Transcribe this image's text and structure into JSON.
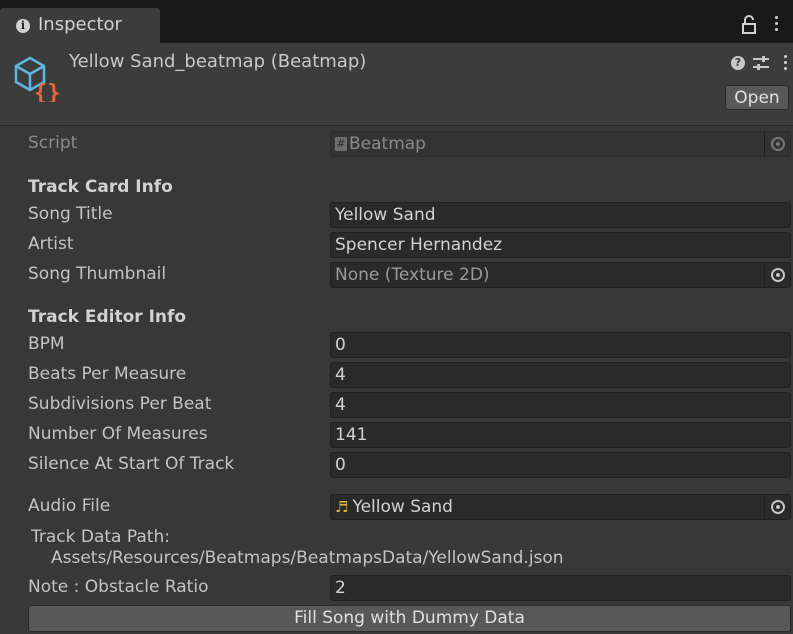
{
  "tab": {
    "label": "Inspector"
  },
  "header": {
    "title": "Yellow Sand_beatmap (Beatmap)",
    "open_label": "Open"
  },
  "script": {
    "label": "Script",
    "value": "Beatmap"
  },
  "track_card": {
    "heading": "Track Card Info",
    "song_title": {
      "label": "Song Title",
      "value": "Yellow Sand"
    },
    "artist": {
      "label": "Artist",
      "value": "Spencer Hernandez"
    },
    "thumbnail": {
      "label": "Song Thumbnail",
      "value": "None (Texture 2D)"
    }
  },
  "track_editor": {
    "heading": "Track Editor Info",
    "bpm": {
      "label": "BPM",
      "value": "0"
    },
    "beats_per_measure": {
      "label": "Beats Per Measure",
      "value": "4"
    },
    "subdivisions": {
      "label": "Subdivisions Per Beat",
      "value": "4"
    },
    "measures": {
      "label": "Number Of Measures",
      "value": "141"
    },
    "silence": {
      "label": "Silence At Start Of Track",
      "value": "0"
    }
  },
  "audio": {
    "label": "Audio File",
    "value": "Yellow Sand"
  },
  "data_path": {
    "label": "Track Data Path:",
    "value": "Assets/Resources/Beatmaps/BeatmapsData/YellowSand.json"
  },
  "ratio": {
    "label": "Note : Obstacle Ratio",
    "value": "2"
  },
  "dummy_button": {
    "label": "Fill Song with Dummy Data"
  },
  "colors": {
    "accent_orange": "#e8643a",
    "asset_blue": "#5fb7e0",
    "music_yellow": "#e8b33a"
  },
  "icons": [
    "info-icon",
    "lock-icon",
    "kebab-menu-icon",
    "scriptable-object-icon",
    "help-icon",
    "preset-icon",
    "object-picker-icon",
    "script-icon",
    "audio-clip-icon"
  ]
}
